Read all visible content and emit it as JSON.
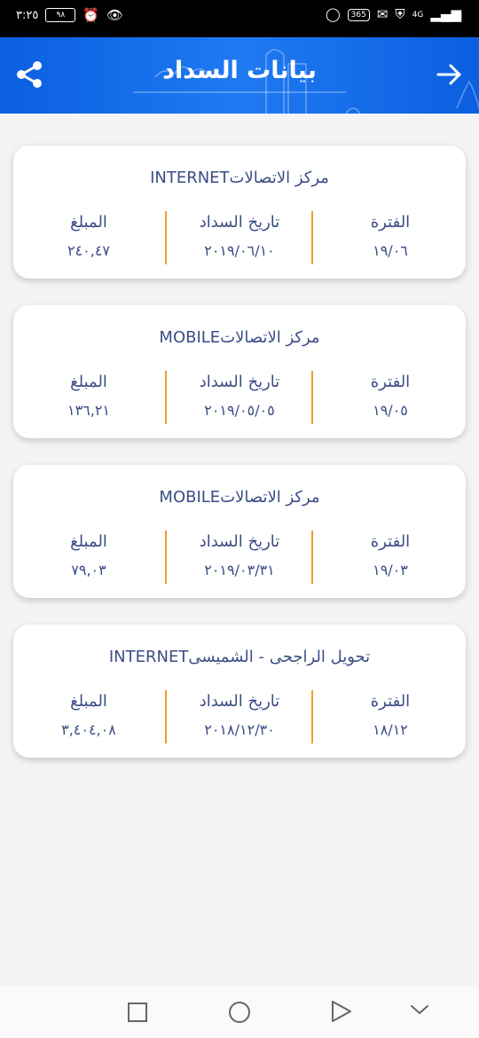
{
  "status_bar": {
    "time": "٣:٢٥",
    "battery": "٩٨",
    "right_badge": "365",
    "network": "4G"
  },
  "appbar": {
    "title": "بيانات السداد",
    "icons": {
      "share": "share-icon",
      "back": "arrow-right-icon"
    }
  },
  "payments": [
    {
      "title": "مركز الاتصالاتINTERNET",
      "period_label": "الفترة",
      "period_value": "١٩/٠٦",
      "date_label": "تاريخ السداد",
      "date_value": "٢٠١٩/٠٦/١٠",
      "amount_label": "المبلغ",
      "amount_value": "٢٤٠,٤٧"
    },
    {
      "title": "مركز الاتصالاتMOBILE",
      "period_label": "الفترة",
      "period_value": "١٩/٠٥",
      "date_label": "تاريخ السداد",
      "date_value": "٢٠١٩/٠٥/٠٥",
      "amount_label": "المبلغ",
      "amount_value": "١٣٦,٢١"
    },
    {
      "title": "مركز الاتصالاتMOBILE",
      "period_label": "الفترة",
      "period_value": "١٩/٠٣",
      "date_label": "تاريخ السداد",
      "date_value": "٢٠١٩/٠٣/٣١",
      "amount_label": "المبلغ",
      "amount_value": "٧٩,٠٣"
    },
    {
      "title": "تحويل الراجحى - الشميسىINTERNET",
      "period_label": "الفترة",
      "period_value": "١٨/١٢",
      "date_label": "تاريخ السداد",
      "date_value": "٢٠١٨/١٢/٣٠",
      "amount_label": "المبلغ",
      "amount_value": "٣,٤٠٤,٠٨"
    }
  ],
  "colors": {
    "appbar": "#1f7af2",
    "text": "#3a4d85",
    "divider": "#f0a020",
    "background": "#f4f4f6"
  }
}
